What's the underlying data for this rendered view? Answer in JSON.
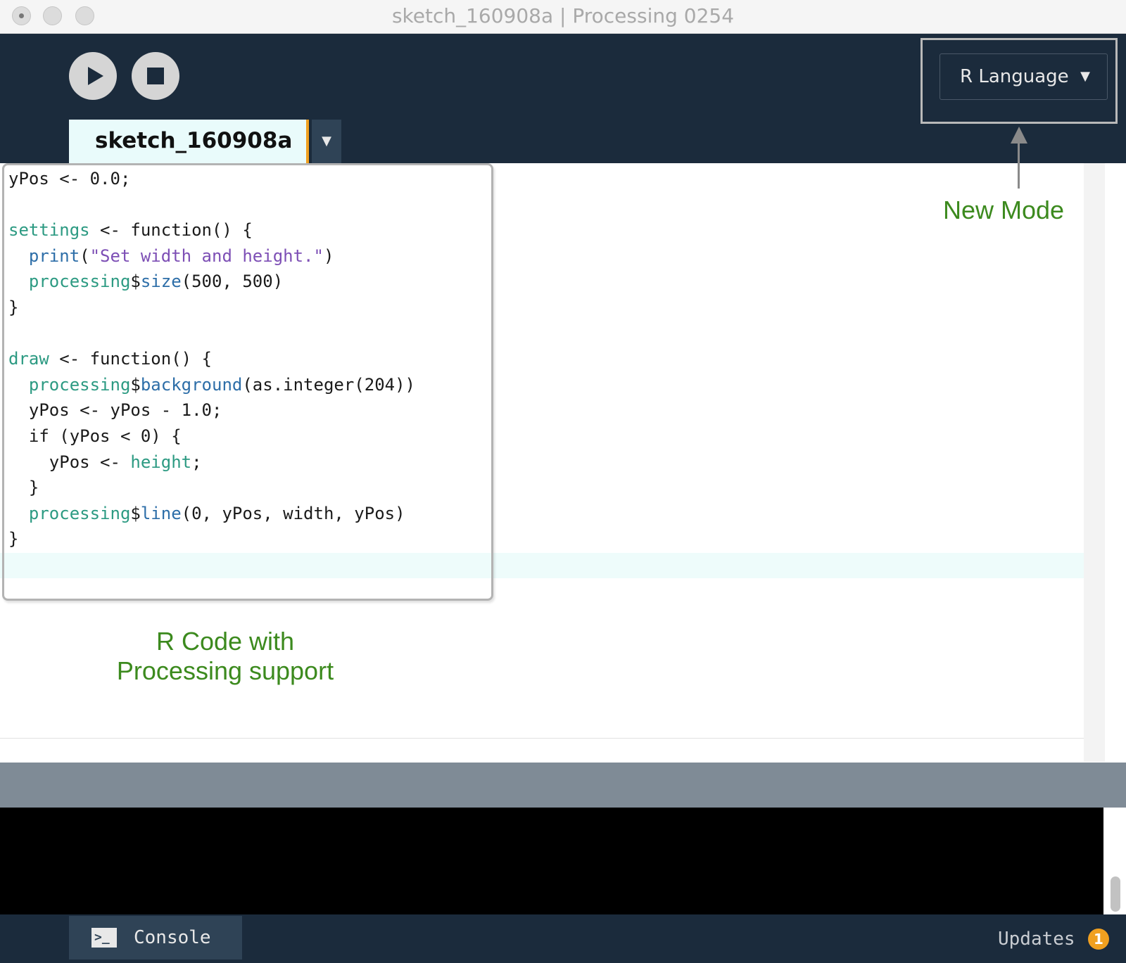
{
  "window": {
    "title": "sketch_160908a | Processing 0254"
  },
  "toolbar": {
    "run_icon": "play-icon",
    "stop_icon": "stop-icon",
    "mode_selector": {
      "value": "R Language",
      "caret": "▼"
    }
  },
  "tabs": [
    {
      "label": "sketch_160908a"
    }
  ],
  "tab_menu": {
    "caret": "▼"
  },
  "editor": {
    "code_lines": [
      "yPos <- 0.0;",
      "",
      "settings <- function() {",
      "  print(\"Set width and height.\")",
      "  processing$size(500, 500)",
      "}",
      "",
      "draw <- function() {",
      "  processing$background(as.integer(204))",
      "  yPos <- yPos - 1.0;",
      "  if (yPos < 0) {",
      "    yPos <- height;",
      "  }",
      "  processing$line(0, yPos, width, yPos)",
      "}"
    ]
  },
  "annotations": {
    "new_mode": "New Mode",
    "r_code_line1": "R Code with",
    "r_code_line2": "Processing support"
  },
  "footer": {
    "console_label": "Console",
    "console_icon": "terminal-icon",
    "console_icon_glyph": ">_",
    "updates_label": "Updates",
    "updates_count": "1"
  },
  "colors": {
    "header_bg": "#1b2b3c",
    "tab_bg": "#e9fbfb",
    "tab_accent": "#f0a020",
    "annotation_green": "#3c8a1e",
    "code_defined": "#2c9a82",
    "code_function": "#2d6ea8",
    "code_string": "#7d4fb5",
    "console_bg": "#000000"
  }
}
